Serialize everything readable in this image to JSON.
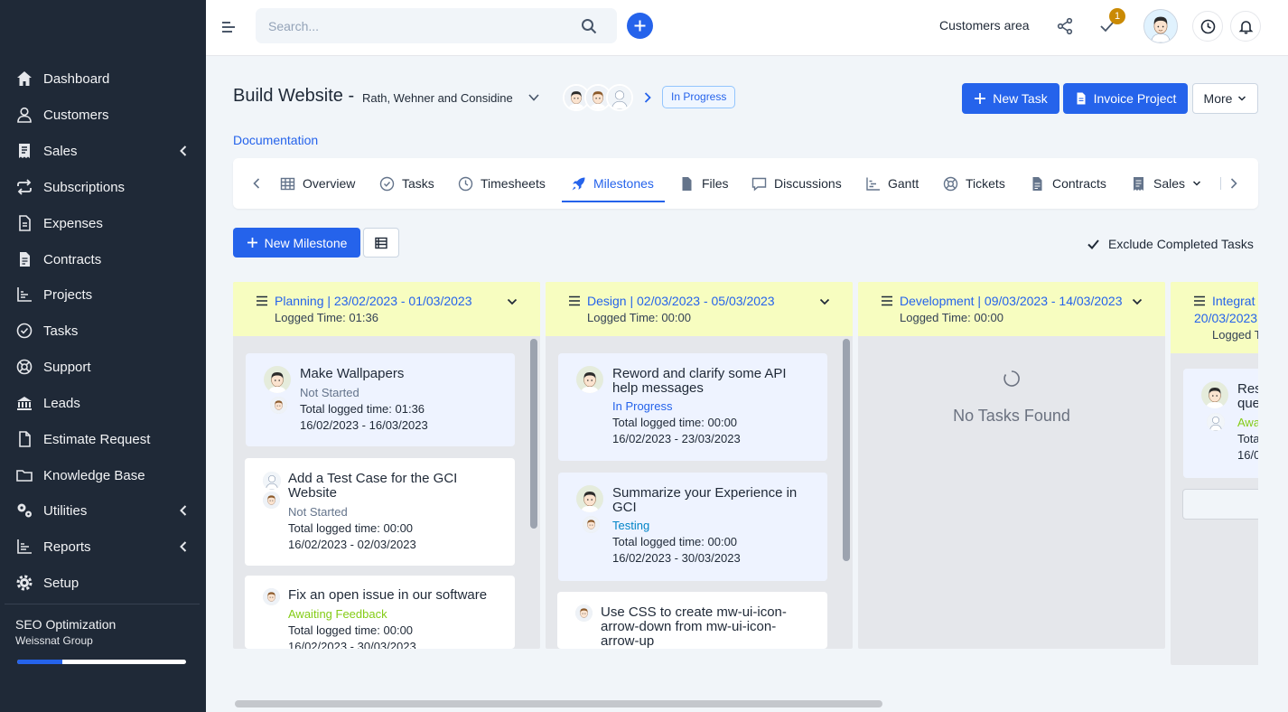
{
  "sidebar": {
    "items": [
      {
        "label": "Dashboard",
        "icon": "home-icon"
      },
      {
        "label": "Customers",
        "icon": "user-icon"
      },
      {
        "label": "Sales",
        "icon": "receipt-icon",
        "has_submenu": true
      },
      {
        "label": "Subscriptions",
        "icon": "repeat-icon"
      },
      {
        "label": "Expenses",
        "icon": "document-icon"
      },
      {
        "label": "Contracts",
        "icon": "contract-icon"
      },
      {
        "label": "Projects",
        "icon": "chart-icon"
      },
      {
        "label": "Tasks",
        "icon": "check-circle-icon"
      },
      {
        "label": "Support",
        "icon": "lifebuoy-icon"
      },
      {
        "label": "Leads",
        "icon": "leads-icon"
      },
      {
        "label": "Estimate Request",
        "icon": "file-icon"
      },
      {
        "label": "Knowledge Base",
        "icon": "folder-icon"
      },
      {
        "label": "Utilities",
        "icon": "cogs-icon",
        "has_submenu": true
      },
      {
        "label": "Reports",
        "icon": "bar-chart-icon",
        "has_submenu": true
      },
      {
        "label": "Setup",
        "icon": "gear-icon"
      }
    ],
    "project": {
      "name": "SEO Optimization",
      "client": "Weissnat Group",
      "progress": 0.27
    }
  },
  "topbar": {
    "search_placeholder": "Search...",
    "customers_area": "Customers area",
    "notification_count": "1"
  },
  "project": {
    "title": "Build Website -",
    "client": "Rath, Wehner and Considine",
    "status": "In Progress",
    "documentation_link": "Documentation",
    "buttons": {
      "new_task": "New Task",
      "invoice_project": "Invoice Project",
      "more": "More"
    }
  },
  "tabs": [
    {
      "label": "Overview",
      "icon": "table-icon"
    },
    {
      "label": "Tasks",
      "icon": "check-circle-icon"
    },
    {
      "label": "Timesheets",
      "icon": "clock-icon"
    },
    {
      "label": "Milestones",
      "icon": "rocket-icon",
      "active": true
    },
    {
      "label": "Files",
      "icon": "file-icon"
    },
    {
      "label": "Discussions",
      "icon": "chat-icon"
    },
    {
      "label": "Gantt",
      "icon": "gantt-icon"
    },
    {
      "label": "Tickets",
      "icon": "lifebuoy-icon"
    },
    {
      "label": "Contracts",
      "icon": "contract-icon"
    },
    {
      "label": "Sales",
      "icon": "receipt-icon",
      "dropdown": true
    }
  ],
  "milestones_toolbar": {
    "new_milestone": "New Milestone",
    "exclude_completed": "Exclude Completed Tasks",
    "exclude_checked": true
  },
  "milestones": [
    {
      "name": "Planning",
      "dates": "| 23/02/2023 - 01/03/2023",
      "logged": "Logged Time: 01:36",
      "tasks": [
        {
          "name": "Make Wallpapers",
          "status": "Not Started",
          "status_color": "#64748b",
          "logged": "Total logged time: 01:36",
          "dates": "16/02/2023 - 16/03/2023"
        },
        {
          "name": "Add a Test Case for the GCI Website",
          "status": "Not Started",
          "status_color": "#64748b",
          "logged": "Total logged time: 00:00",
          "dates": "16/02/2023 - 02/03/2023"
        },
        {
          "name": "Fix an open issue in our software",
          "status": "Awaiting Feedback",
          "status_color": "#84cc16",
          "logged": "Total logged time: 00:00",
          "dates": "16/02/2023 - 30/03/2023"
        }
      ]
    },
    {
      "name": "Design",
      "dates": "| 02/03/2023 - 05/03/2023",
      "logged": "Logged Time: 00:00",
      "tasks": [
        {
          "name": "Reword and clarify some API help messages",
          "status": "In Progress",
          "status_color": "#2563eb",
          "logged": "Total logged time: 00:00",
          "dates": "16/02/2023 - 23/03/2023"
        },
        {
          "name": "Summarize your Experience in GCI",
          "status": "Testing",
          "status_color": "#0284c7",
          "logged": "Total logged time: 00:00",
          "dates": "16/02/2023 - 30/03/2023"
        },
        {
          "name": "Use CSS to create mw-ui-icon-arrow-down from mw-ui-icon-arrow-up"
        }
      ]
    },
    {
      "name": "Development",
      "dates": "| 09/03/2023 - 14/03/2023",
      "logged": "Logged Time: 00:00",
      "empty_text": "No Tasks Found"
    },
    {
      "name": "Integrat",
      "dates": "20/03/2023",
      "logged": "Logged T",
      "tasks": [
        {
          "name": "Res",
          "name2": "que",
          "status": "Awa",
          "status_color": "#84cc16",
          "logged": "Tota",
          "dates": "16/0"
        }
      ]
    }
  ]
}
